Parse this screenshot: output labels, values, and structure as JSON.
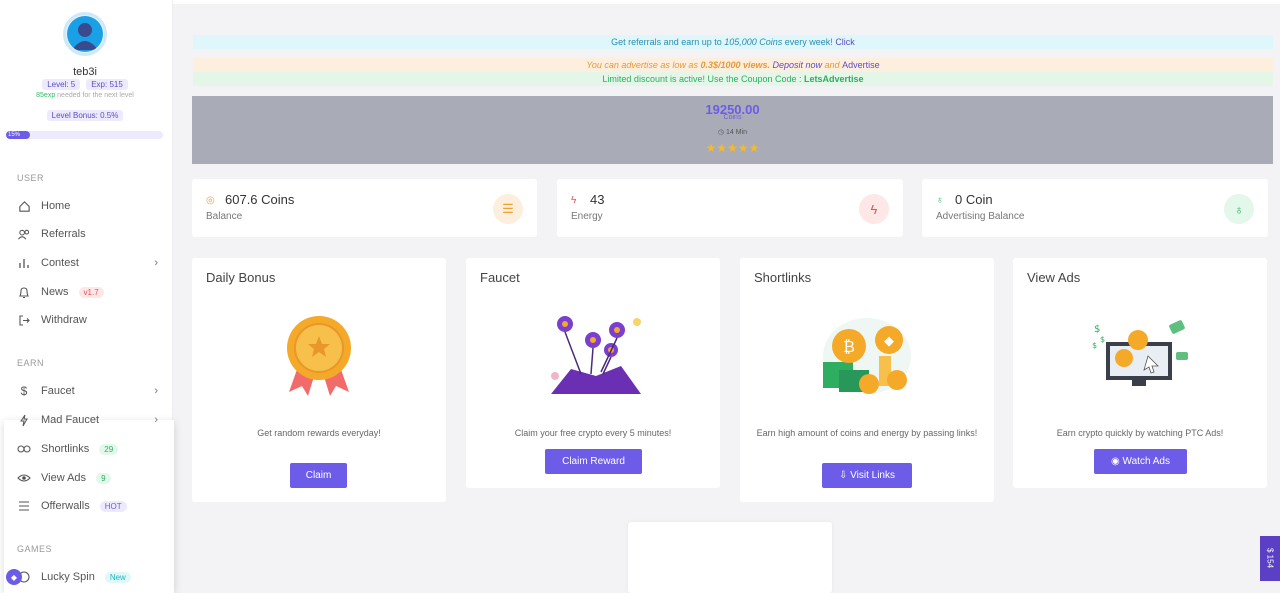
{
  "sidebar": {
    "username": "teb3i",
    "level": "Level: 5",
    "exp": "Exp: 515",
    "xp_needed_value": "85exp",
    "xp_needed_text": " needed for the next level",
    "level_bonus": "Level Bonus: 0.5%",
    "progress_label": "15%",
    "progress": 0.15,
    "section_user": "USER",
    "section_earn": "EARN",
    "section_games": "GAMES",
    "items": [
      {
        "label": "Home",
        "icon": "home-icon"
      },
      {
        "label": "Referrals",
        "icon": "users-icon"
      },
      {
        "label": "Contest",
        "icon": "chart-icon"
      },
      {
        "label": "News",
        "icon": "bell-icon",
        "badge": "v1.7"
      },
      {
        "label": "Withdraw",
        "icon": "logout-icon"
      },
      {
        "label": "Faucet",
        "icon": "dollar-icon"
      },
      {
        "label": "Mad Faucet",
        "icon": "bolt-icon"
      },
      {
        "label": "Shortlinks",
        "icon": "link-icon",
        "badge": "29"
      },
      {
        "label": "View Ads",
        "icon": "eye-icon",
        "badge": "9"
      },
      {
        "label": "Offerwalls",
        "icon": "list-icon",
        "badge": "HOT"
      },
      {
        "label": "Lucky Spin",
        "icon": "spin-icon",
        "badge": "New"
      }
    ]
  },
  "banners": {
    "referral_text": "Get referrals and earn up to ",
    "referral_amount": "105,000 Coins",
    "referral_suffix": " every week! ",
    "referral_link": "Click",
    "advertise_text": "You can advertise as low as ",
    "advertise_price": "0.3$/1000 views.",
    "advertise_deposit": " Deposit now",
    "advertise_and": " and ",
    "advertise_link": "Advertise",
    "discount_text": "Limited discount is active! Use the Coupon Code : ",
    "discount_code": "LetsAdvertise"
  },
  "coinbox": {
    "amount": "19250.00",
    "label": "Coins",
    "time": "14 Min",
    "stars": 5
  },
  "stats": [
    {
      "value": "607.6 Coins",
      "label": "Balance",
      "icon": "coins-icon"
    },
    {
      "value": "43",
      "label": "Energy",
      "icon": "bolt-icon"
    },
    {
      "value": "0 Coin",
      "label": "Advertising Balance",
      "icon": "award-icon"
    }
  ],
  "cards": [
    {
      "title": "Daily Bonus",
      "desc": "Get random rewards everyday!",
      "button": "Claim"
    },
    {
      "title": "Faucet",
      "desc": "Claim your free crypto every 5 minutes!",
      "button": "Claim Reward"
    },
    {
      "title": "Shortlinks",
      "desc": "Earn high amount of coins and energy by passing links!",
      "button": "Visit Links"
    },
    {
      "title": "View Ads",
      "desc": "Earn crypto quickly by watching PTC Ads!",
      "button": "Watch Ads"
    }
  ],
  "side_tab": "$ 154",
  "colors": {
    "accent": "#6c5ce7",
    "success": "#2fae62",
    "warning": "#f7b924",
    "danger": "#e55353"
  }
}
